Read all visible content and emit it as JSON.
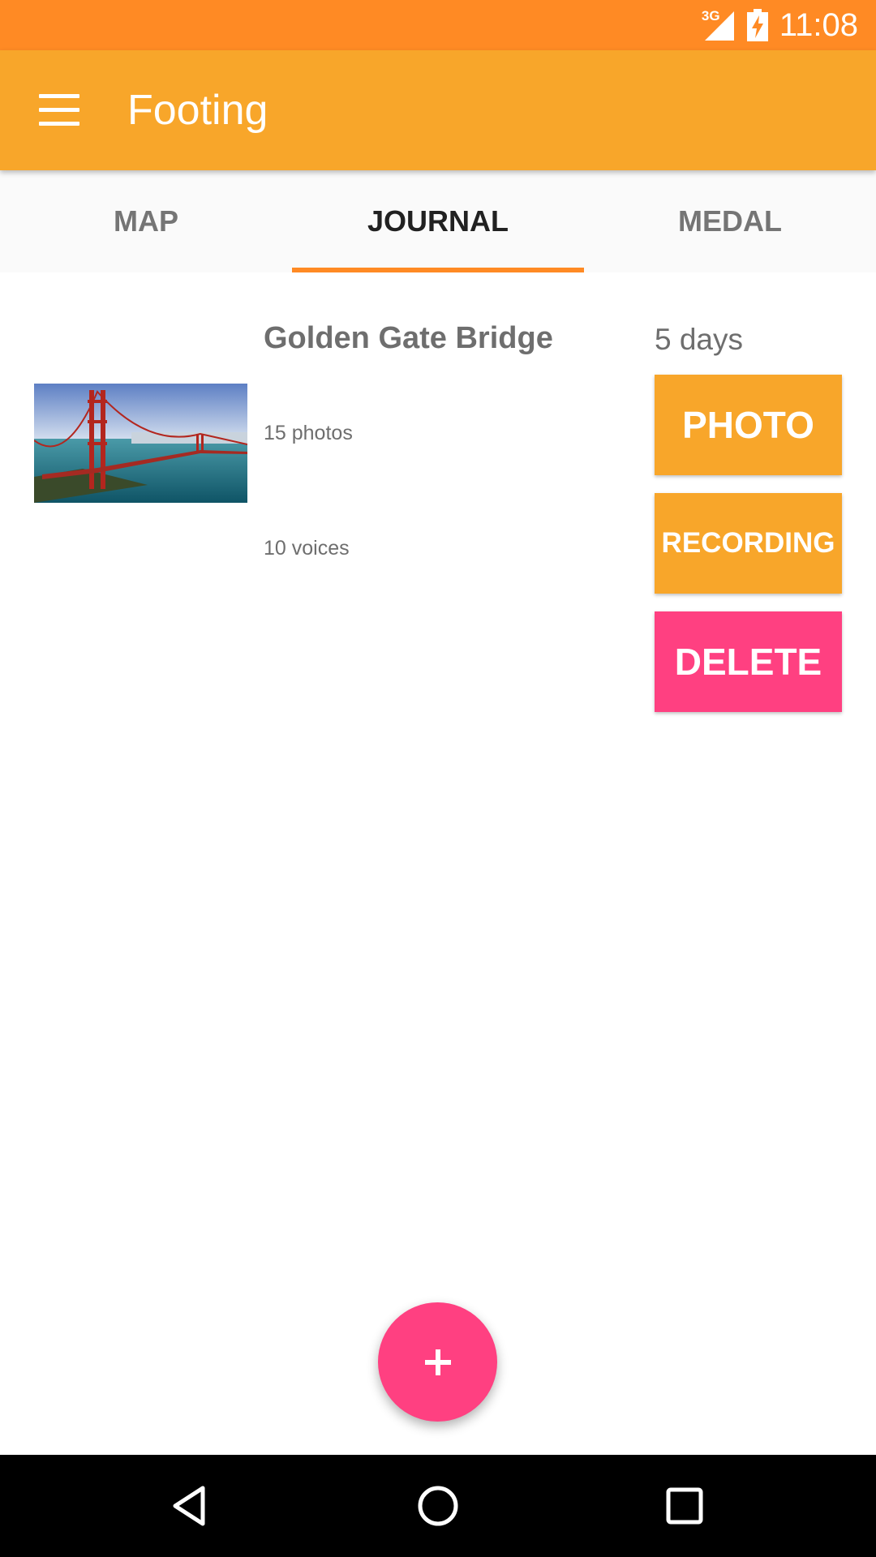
{
  "status_bar": {
    "network_type": "3G",
    "time": "11:08",
    "icons": [
      "signal-icon",
      "battery-charging-icon"
    ]
  },
  "app_bar": {
    "title": "Footing",
    "menu_icon": "hamburger-menu-icon"
  },
  "tabs": {
    "items": [
      {
        "label": "MAP",
        "active": false
      },
      {
        "label": "JOURNAL",
        "active": true
      },
      {
        "label": "MEDAL",
        "active": false
      }
    ],
    "indicator_color": "#FF8A24"
  },
  "journal": {
    "entries": [
      {
        "title": "Golden Gate Bridge",
        "photos": "15 photos",
        "voices": "10 voices",
        "duration": "5 days",
        "thumbnail": "golden-gate-bridge-photo",
        "actions": {
          "photo": "PHOTO",
          "recording": "RECORDING",
          "delete": "DELETE"
        }
      }
    ]
  },
  "fab": {
    "icon": "plus-icon"
  },
  "nav_bar": {
    "icons": [
      "back-icon",
      "home-icon",
      "recents-icon"
    ]
  },
  "colors": {
    "status_bar": "#FF8A24",
    "primary": "#F8A62A",
    "accent": "#FF4081",
    "text_secondary": "#6E6E6E"
  }
}
